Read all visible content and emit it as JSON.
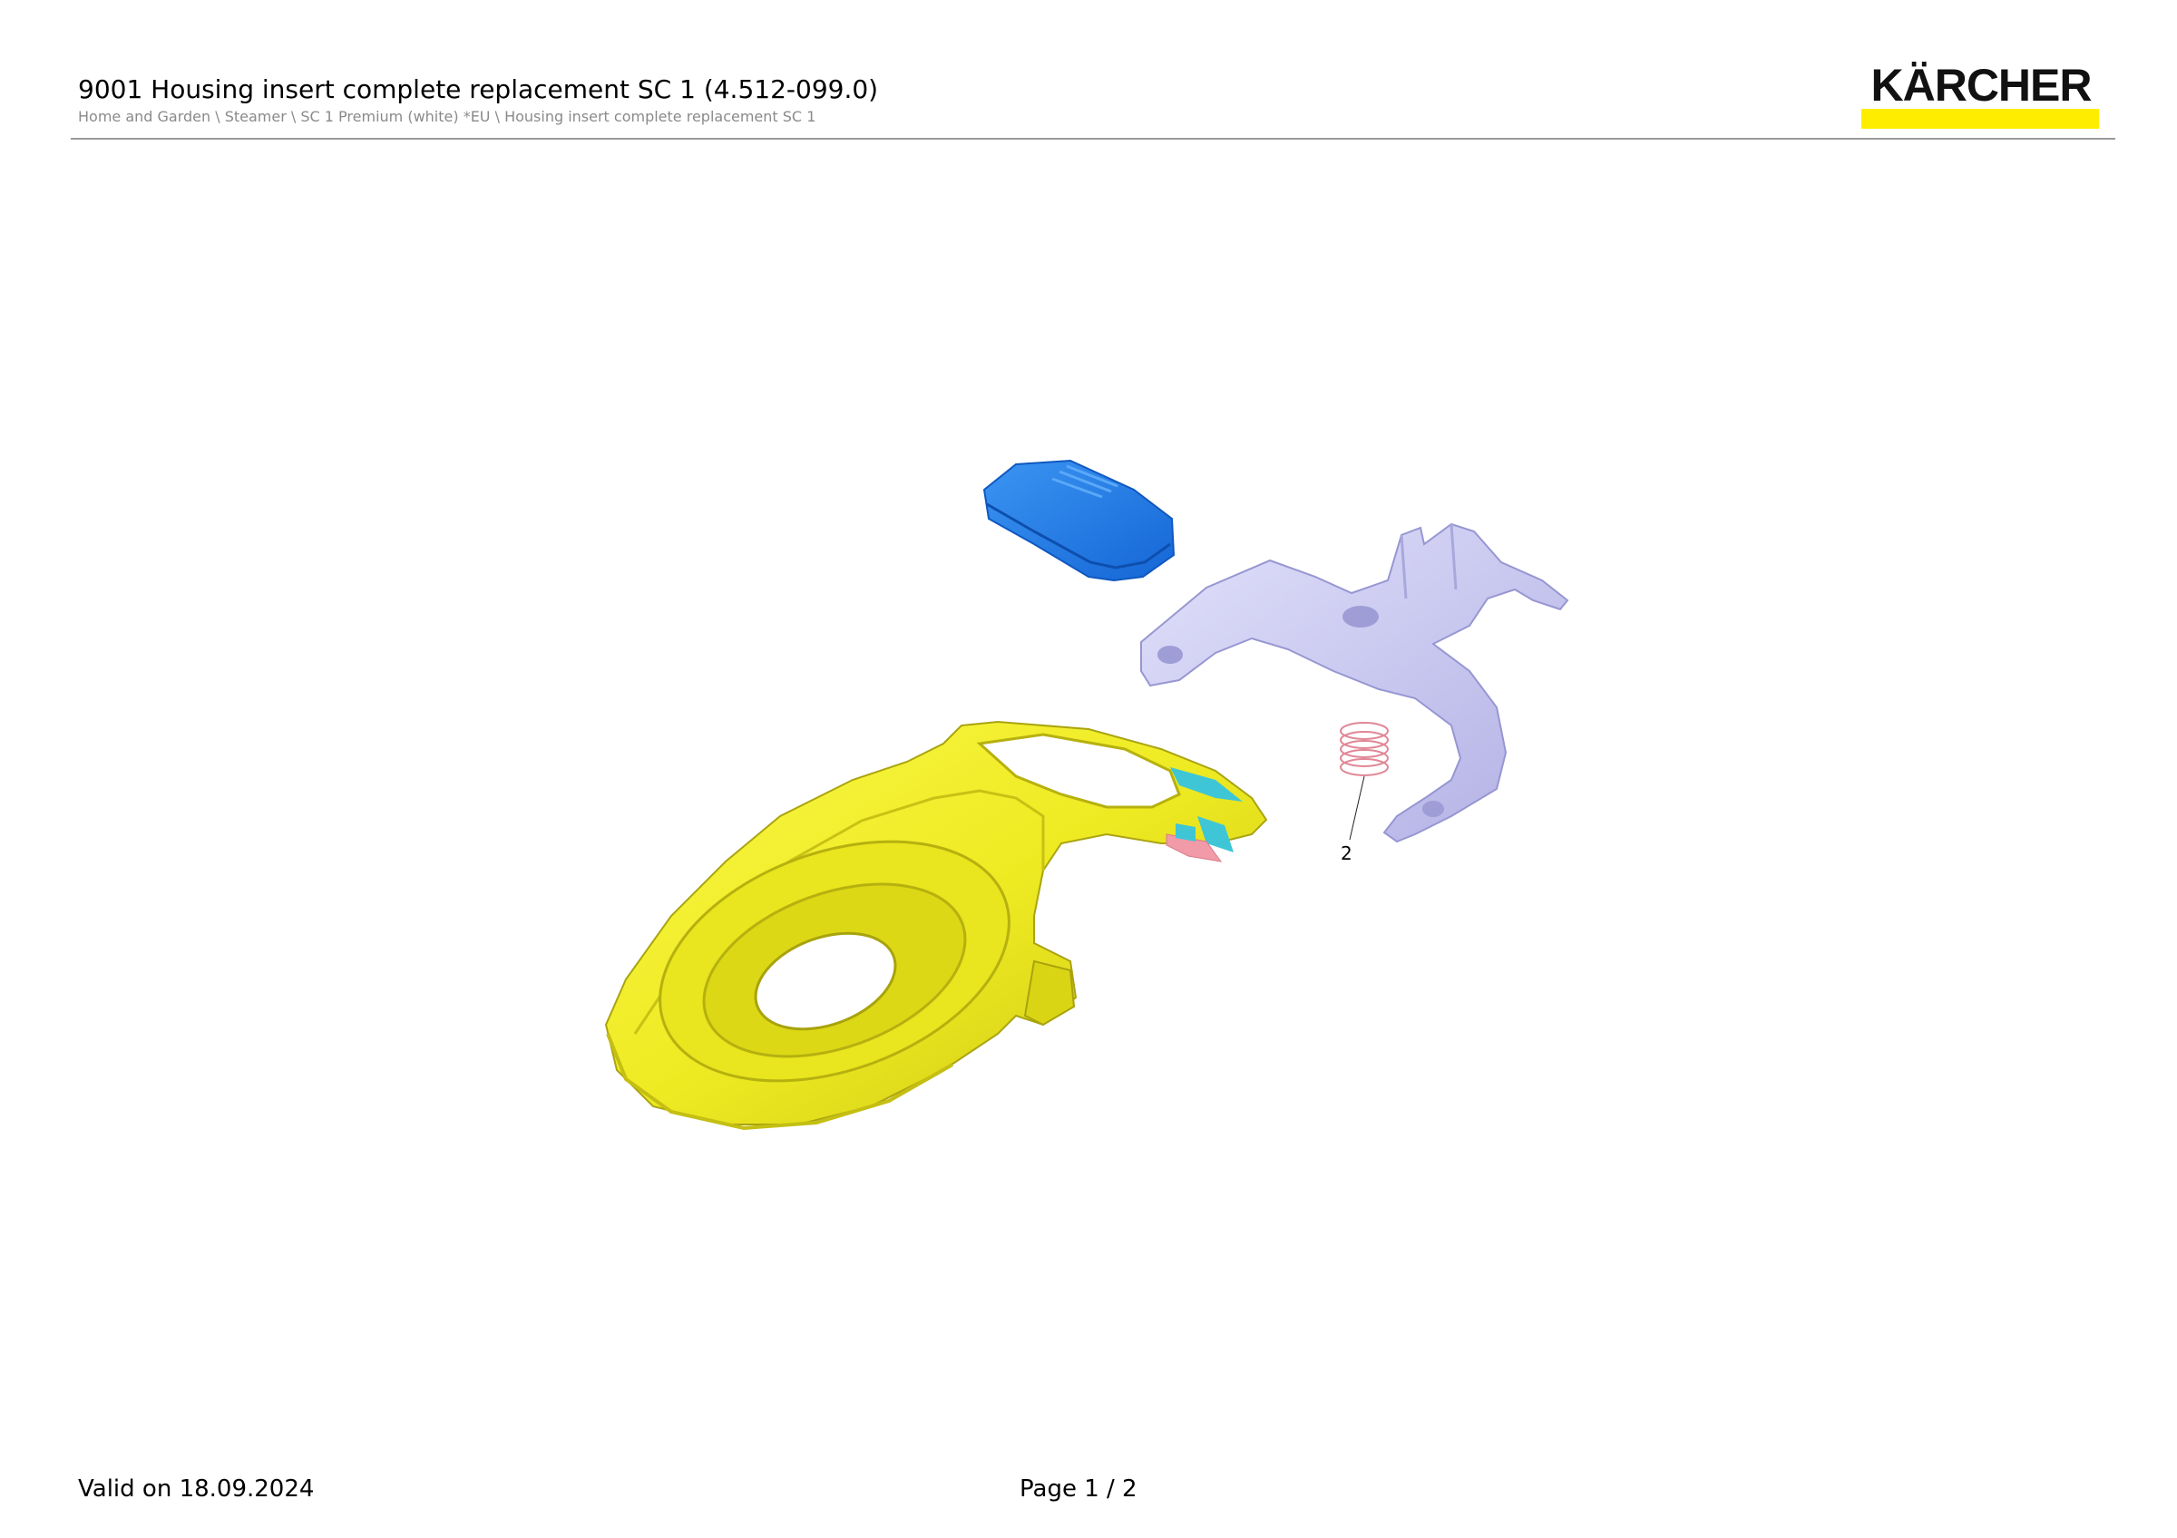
{
  "header": {
    "title": "9001 Housing insert complete replacement SC 1 (4.512-099.0)",
    "breadcrumb": "Home and Garden \\ Steamer \\ SC 1 Premium (white) *EU \\ Housing insert complete replacement SC 1"
  },
  "logo": {
    "text": "KÄRCHER",
    "bar_color": "#ffed00"
  },
  "drawing": {
    "callouts": [
      {
        "number": "2"
      }
    ],
    "part_colors": {
      "housing_insert": "#f2ef2a",
      "button_cap": "#1e7fe6",
      "bracket": "#c9c8f2",
      "spring": "#e88a9a",
      "detail_cyan": "#3ec6d6",
      "detail_pink": "#f19aa8"
    }
  },
  "footer": {
    "valid_on": "Valid on 18.09.2024",
    "page": "Page 1 / 2"
  }
}
